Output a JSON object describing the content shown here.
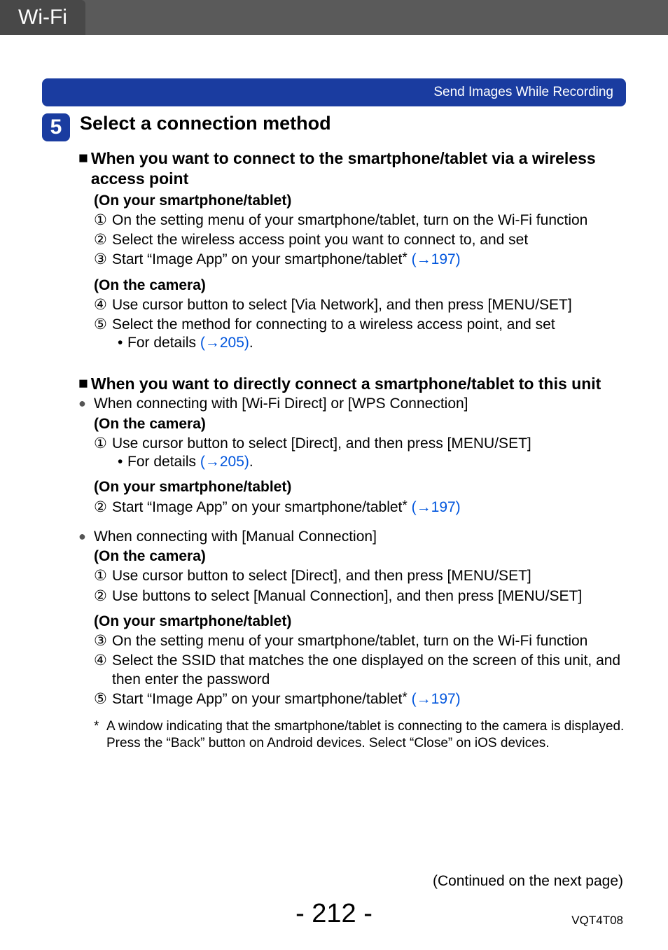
{
  "header": {
    "tab": "Wi-Fi"
  },
  "bluebar": {
    "title": "Send Images While Recording"
  },
  "step": {
    "number": "5",
    "title": "Select a connection method"
  },
  "sec1": {
    "heading": "When you want to connect to the smartphone/tablet via a wireless access point",
    "groupA_title": "(On your smartphone/tablet)",
    "a1": "On the setting menu of your smartphone/tablet, turn on the Wi-Fi function",
    "a2": "Select the wireless access point you want to connect to, and set",
    "a3": "Start “Image App” on your smartphone/tablet",
    "a3_link": "(→197)",
    "groupB_title": "(On the camera)",
    "b4": "Use cursor button to select [Via Network], and then press [MENU/SET]",
    "b5": "Select the method for connecting to a wireless access point, and set",
    "b5_detail_prefix": "For details ",
    "b5_detail_link": "(→205)",
    "b5_detail_suffix": "."
  },
  "sec2": {
    "heading": "When you want to directly connect a smartphone/tablet to this unit",
    "bullet1": "When connecting with [Wi-Fi Direct] or [WPS Connection]",
    "b1_cam_title": "(On the camera)",
    "b1_c1": "Use cursor button to select [Direct], and then press [MENU/SET]",
    "b1_c1_detail_prefix": "For details ",
    "b1_c1_detail_link": "(→205)",
    "b1_c1_detail_suffix": ".",
    "b1_sp_title": "(On your smartphone/tablet)",
    "b1_s2": "Start “Image App” on your smartphone/tablet",
    "b1_s2_link": "(→197)",
    "bullet2": "When connecting with [Manual Connection]",
    "b2_cam_title": "(On the camera)",
    "b2_c1": "Use cursor button to select [Direct], and then press [MENU/SET]",
    "b2_c2": "Use buttons to select [Manual Connection], and then press [MENU/SET]",
    "b2_sp_title": "(On your smartphone/tablet)",
    "b2_s3": "On the setting menu of your smartphone/tablet, turn on the Wi-Fi function",
    "b2_s4": "Select the SSID that matches the one displayed on the screen of this unit, and then enter the password",
    "b2_s5": "Start “Image App” on your smartphone/tablet",
    "b2_s5_link": "(→197)"
  },
  "footnote": {
    "mark": "*",
    "text": "A window indicating that the smartphone/tablet is connecting to the camera is displayed. Press the “Back” button on Android devices. Select “Close” on iOS devices."
  },
  "marks": {
    "square": "■",
    "bullet": "●",
    "dot": "•",
    "c1": "①",
    "c2": "②",
    "c3": "③",
    "c4": "④",
    "c5": "⑤",
    "ast": "*"
  },
  "footer": {
    "continued": "(Continued on the next page)",
    "page": "- 212 -",
    "code": "VQT4T08"
  }
}
